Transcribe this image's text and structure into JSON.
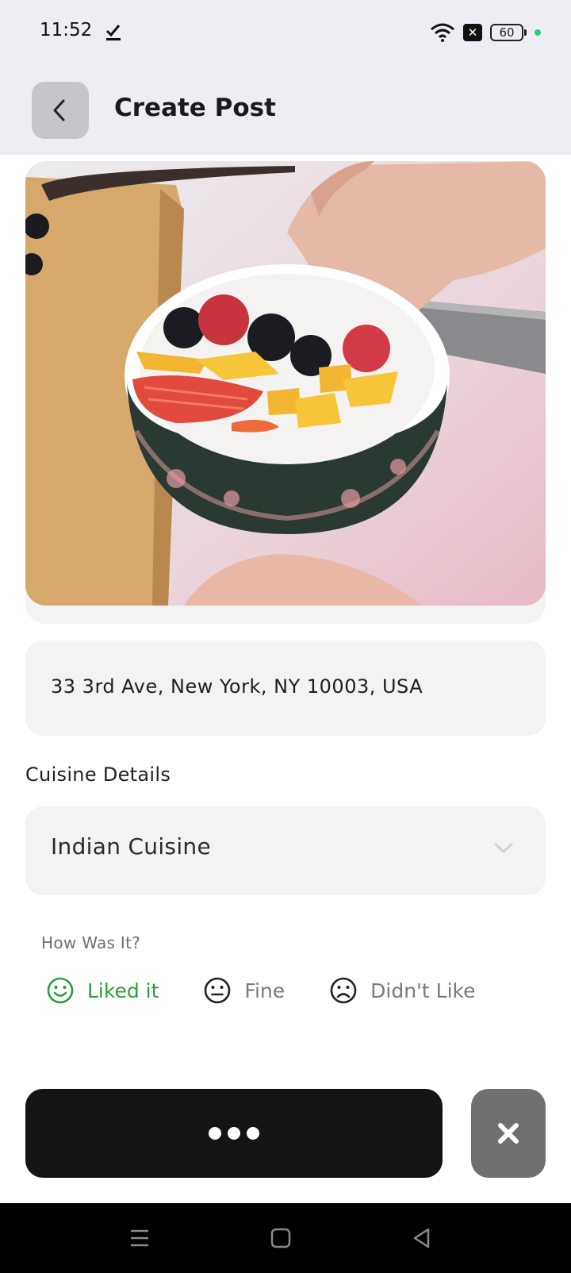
{
  "status_bar": {
    "time": "11:52",
    "battery": "60",
    "sim_badge": "✕"
  },
  "app_bar": {
    "title": "Create Post"
  },
  "post": {
    "address": "33 3rd Ave, New York, NY 10003, USA",
    "cuisine_section_label": "Cuisine Details",
    "cuisine_value": "Indian Cuisine",
    "rating_question": "How Was It?",
    "rating_options": [
      {
        "label": "Liked it",
        "icon": "smile-icon",
        "selected": true
      },
      {
        "label": "Fine",
        "icon": "neutral-face-icon",
        "selected": false
      },
      {
        "label": "Didn't Like",
        "icon": "frown-icon",
        "selected": false
      }
    ]
  },
  "colors": {
    "accent_green": "#2e9d3d",
    "submit_bg": "#141414",
    "close_bg": "#707070",
    "field_bg": "#f3f3f3",
    "header_bg": "#efedf4"
  }
}
